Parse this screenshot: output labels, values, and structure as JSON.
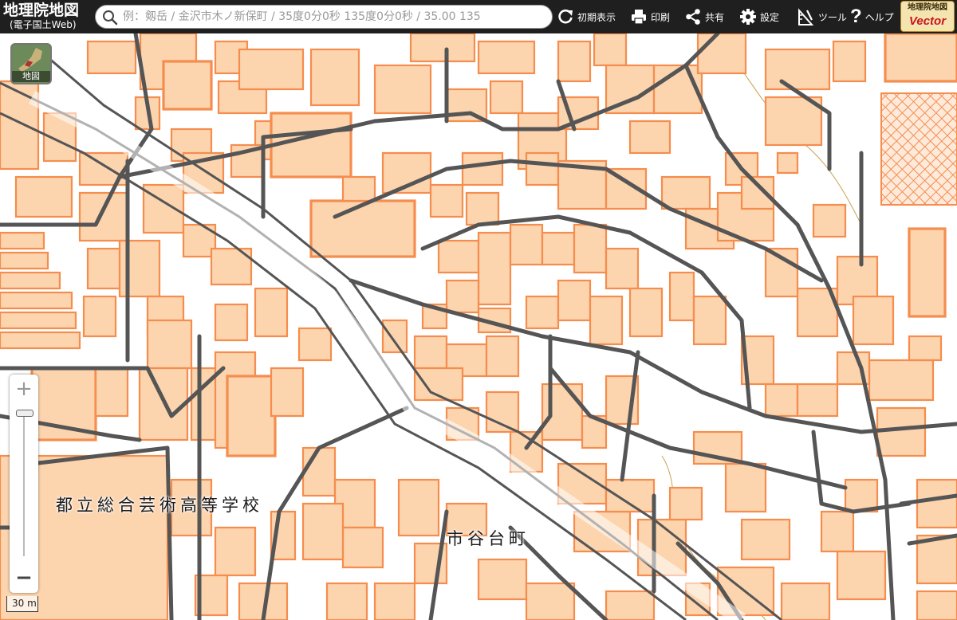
{
  "header": {
    "app_title": "地理院地図",
    "app_subtitle": "(電子国土Web)",
    "search_placeholder": "例：剱岳 / 金沢市木ノ新保町 / 35度0分0秒 135度0分0秒 / 35.00 135",
    "buttons": {
      "reset": "初期表示",
      "print": "印刷",
      "share": "共有",
      "settings": "設定",
      "tools": "ツール",
      "help": "ヘルプ"
    },
    "vector_badge": {
      "top": "地理院地図",
      "bottom": "Vector"
    }
  },
  "map": {
    "base_map_button": "地図",
    "labels": {
      "school": "都立総合芸術高等学校",
      "town": "市谷台町"
    },
    "zoom": {
      "in": "+",
      "out": "−"
    },
    "scale": "30 m"
  },
  "colors": {
    "header_bg": "#1f1f1f",
    "building_fill": "#fcd4ae",
    "building_stroke": "#f58d4e",
    "road": "#555555",
    "vector_red": "#c8161d"
  }
}
